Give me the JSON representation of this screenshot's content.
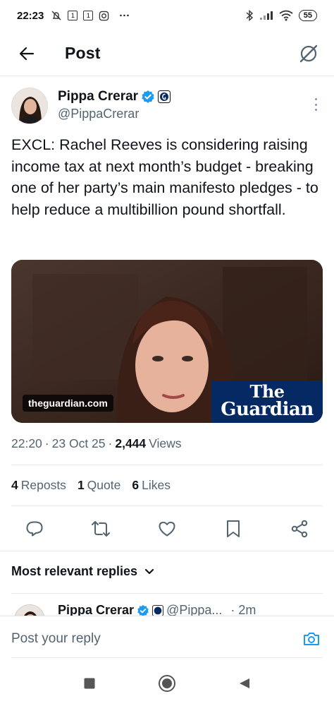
{
  "status_bar": {
    "time": "22:23",
    "box1": "1",
    "box2": "1",
    "overflow": "···",
    "battery": "55"
  },
  "header": {
    "title": "Post"
  },
  "author": {
    "name": "Pippa Crerar",
    "handle": "@PippaCrerar"
  },
  "tweet": {
    "text": "EXCL: Rachel Reeves is considering raising income tax at next month’s budget - breaking one of her party’s main manifesto pledges - to help reduce a multibillion pound shortfall."
  },
  "card": {
    "domain": "theguardian.com",
    "brand_line1": "The",
    "brand_line2": "Guardian"
  },
  "meta": {
    "time": "22:20",
    "sep1": "·",
    "date": "23 Oct 25",
    "sep2": "·",
    "views_count": "2,444",
    "views_label": "Views"
  },
  "stats": {
    "reposts_count": "4",
    "reposts_label": "Reposts",
    "quotes_count": "1",
    "quotes_label": "Quote",
    "likes_count": "6",
    "likes_label": "Likes"
  },
  "replies": {
    "sort_label": "Most relevant replies"
  },
  "reply_peek": {
    "name": "Pippa Crerar",
    "handle": "@Pippa...",
    "time": "· 2m"
  },
  "composer": {
    "placeholder": "Post your reply"
  },
  "colors": {
    "accent": "#1d9bf0",
    "text": "#0f1419",
    "muted": "#536471",
    "guardian_blue": "#052962"
  },
  "icons": {
    "back": "arrow-left-icon",
    "grok": "grok-icon",
    "verified": "verified-badge-icon",
    "affiliate": "guardian-affiliate-icon",
    "reply": "reply-icon",
    "repost": "repost-icon",
    "like": "heart-icon",
    "bookmark": "bookmark-icon",
    "share": "share-icon",
    "camera": "camera-icon"
  }
}
